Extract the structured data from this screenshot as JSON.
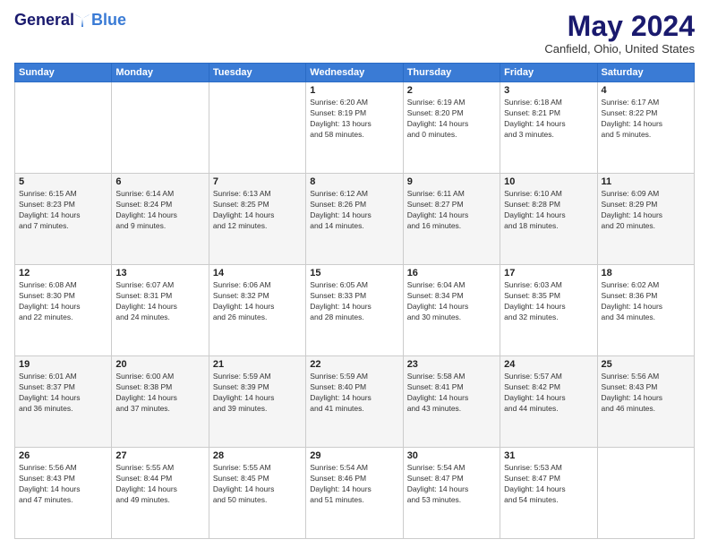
{
  "header": {
    "logo_general": "General",
    "logo_blue": "Blue",
    "month_title": "May 2024",
    "location": "Canfield, Ohio, United States"
  },
  "weekdays": [
    "Sunday",
    "Monday",
    "Tuesday",
    "Wednesday",
    "Thursday",
    "Friday",
    "Saturday"
  ],
  "weeks": [
    [
      {
        "day": "",
        "info": ""
      },
      {
        "day": "",
        "info": ""
      },
      {
        "day": "",
        "info": ""
      },
      {
        "day": "1",
        "info": "Sunrise: 6:20 AM\nSunset: 8:19 PM\nDaylight: 13 hours\nand 58 minutes."
      },
      {
        "day": "2",
        "info": "Sunrise: 6:19 AM\nSunset: 8:20 PM\nDaylight: 14 hours\nand 0 minutes."
      },
      {
        "day": "3",
        "info": "Sunrise: 6:18 AM\nSunset: 8:21 PM\nDaylight: 14 hours\nand 3 minutes."
      },
      {
        "day": "4",
        "info": "Sunrise: 6:17 AM\nSunset: 8:22 PM\nDaylight: 14 hours\nand 5 minutes."
      }
    ],
    [
      {
        "day": "5",
        "info": "Sunrise: 6:15 AM\nSunset: 8:23 PM\nDaylight: 14 hours\nand 7 minutes."
      },
      {
        "day": "6",
        "info": "Sunrise: 6:14 AM\nSunset: 8:24 PM\nDaylight: 14 hours\nand 9 minutes."
      },
      {
        "day": "7",
        "info": "Sunrise: 6:13 AM\nSunset: 8:25 PM\nDaylight: 14 hours\nand 12 minutes."
      },
      {
        "day": "8",
        "info": "Sunrise: 6:12 AM\nSunset: 8:26 PM\nDaylight: 14 hours\nand 14 minutes."
      },
      {
        "day": "9",
        "info": "Sunrise: 6:11 AM\nSunset: 8:27 PM\nDaylight: 14 hours\nand 16 minutes."
      },
      {
        "day": "10",
        "info": "Sunrise: 6:10 AM\nSunset: 8:28 PM\nDaylight: 14 hours\nand 18 minutes."
      },
      {
        "day": "11",
        "info": "Sunrise: 6:09 AM\nSunset: 8:29 PM\nDaylight: 14 hours\nand 20 minutes."
      }
    ],
    [
      {
        "day": "12",
        "info": "Sunrise: 6:08 AM\nSunset: 8:30 PM\nDaylight: 14 hours\nand 22 minutes."
      },
      {
        "day": "13",
        "info": "Sunrise: 6:07 AM\nSunset: 8:31 PM\nDaylight: 14 hours\nand 24 minutes."
      },
      {
        "day": "14",
        "info": "Sunrise: 6:06 AM\nSunset: 8:32 PM\nDaylight: 14 hours\nand 26 minutes."
      },
      {
        "day": "15",
        "info": "Sunrise: 6:05 AM\nSunset: 8:33 PM\nDaylight: 14 hours\nand 28 minutes."
      },
      {
        "day": "16",
        "info": "Sunrise: 6:04 AM\nSunset: 8:34 PM\nDaylight: 14 hours\nand 30 minutes."
      },
      {
        "day": "17",
        "info": "Sunrise: 6:03 AM\nSunset: 8:35 PM\nDaylight: 14 hours\nand 32 minutes."
      },
      {
        "day": "18",
        "info": "Sunrise: 6:02 AM\nSunset: 8:36 PM\nDaylight: 14 hours\nand 34 minutes."
      }
    ],
    [
      {
        "day": "19",
        "info": "Sunrise: 6:01 AM\nSunset: 8:37 PM\nDaylight: 14 hours\nand 36 minutes."
      },
      {
        "day": "20",
        "info": "Sunrise: 6:00 AM\nSunset: 8:38 PM\nDaylight: 14 hours\nand 37 minutes."
      },
      {
        "day": "21",
        "info": "Sunrise: 5:59 AM\nSunset: 8:39 PM\nDaylight: 14 hours\nand 39 minutes."
      },
      {
        "day": "22",
        "info": "Sunrise: 5:59 AM\nSunset: 8:40 PM\nDaylight: 14 hours\nand 41 minutes."
      },
      {
        "day": "23",
        "info": "Sunrise: 5:58 AM\nSunset: 8:41 PM\nDaylight: 14 hours\nand 43 minutes."
      },
      {
        "day": "24",
        "info": "Sunrise: 5:57 AM\nSunset: 8:42 PM\nDaylight: 14 hours\nand 44 minutes."
      },
      {
        "day": "25",
        "info": "Sunrise: 5:56 AM\nSunset: 8:43 PM\nDaylight: 14 hours\nand 46 minutes."
      }
    ],
    [
      {
        "day": "26",
        "info": "Sunrise: 5:56 AM\nSunset: 8:43 PM\nDaylight: 14 hours\nand 47 minutes."
      },
      {
        "day": "27",
        "info": "Sunrise: 5:55 AM\nSunset: 8:44 PM\nDaylight: 14 hours\nand 49 minutes."
      },
      {
        "day": "28",
        "info": "Sunrise: 5:55 AM\nSunset: 8:45 PM\nDaylight: 14 hours\nand 50 minutes."
      },
      {
        "day": "29",
        "info": "Sunrise: 5:54 AM\nSunset: 8:46 PM\nDaylight: 14 hours\nand 51 minutes."
      },
      {
        "day": "30",
        "info": "Sunrise: 5:54 AM\nSunset: 8:47 PM\nDaylight: 14 hours\nand 53 minutes."
      },
      {
        "day": "31",
        "info": "Sunrise: 5:53 AM\nSunset: 8:47 PM\nDaylight: 14 hours\nand 54 minutes."
      },
      {
        "day": "",
        "info": ""
      }
    ]
  ]
}
